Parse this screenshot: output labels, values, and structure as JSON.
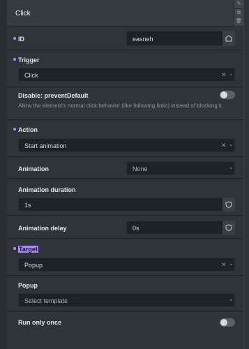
{
  "header": {
    "title": "Click",
    "actions": [
      "edit-icon",
      "duplicate-icon",
      "delete-icon"
    ]
  },
  "rows": {
    "id": {
      "label": "ID",
      "value": "easneh"
    },
    "trigger": {
      "label": "Trigger",
      "value": "Click"
    },
    "disable": {
      "label": "Disable: preventDefault",
      "description": "Allow the element's normal click behavior (like following links) instead of blocking it.",
      "enabled": false
    },
    "action": {
      "label": "Action",
      "value": "Start animation"
    },
    "animation": {
      "label": "Animation",
      "value": "None"
    },
    "duration": {
      "label": "Animation duration",
      "value": "1s"
    },
    "delay": {
      "label": "Animation delay",
      "value": "0s"
    },
    "target": {
      "label": "Target",
      "value": "Popup"
    },
    "popup": {
      "label": "Popup",
      "placeholder": "Select template"
    },
    "run_once": {
      "label": "Run only once",
      "enabled": false
    }
  },
  "colors": {
    "accent": "#a78bfa",
    "background": "#2f343a",
    "field": "#1e2125"
  }
}
